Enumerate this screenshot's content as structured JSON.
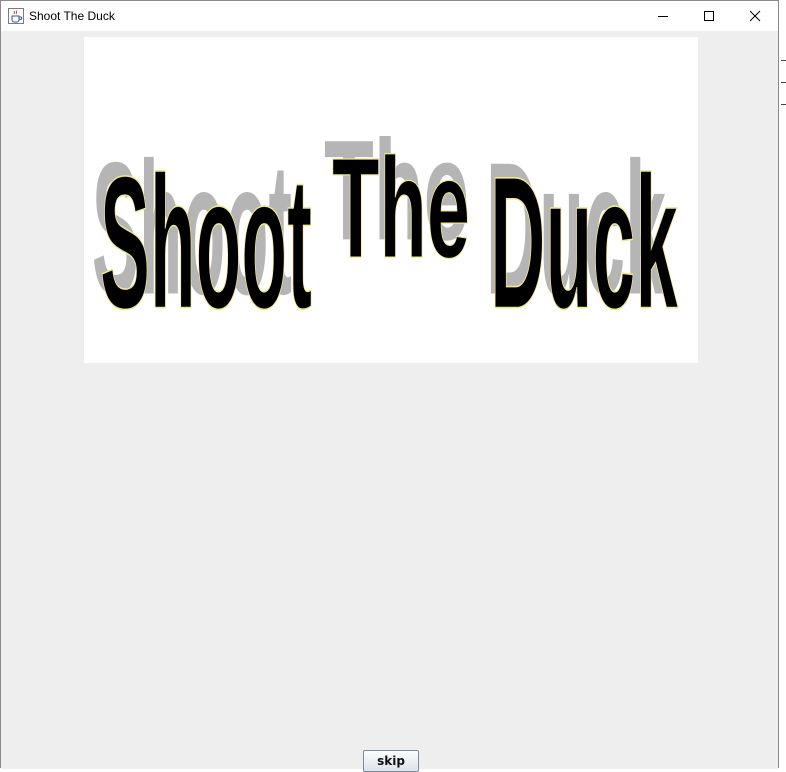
{
  "window": {
    "title": "Shoot The Duck",
    "icon": "java-cup-icon"
  },
  "controls": {
    "minimize_icon": "minimize-icon",
    "maximize_icon": "maximize-icon",
    "close_icon": "close-icon"
  },
  "banner": {
    "words": [
      "Shoot",
      "The",
      "Duck"
    ],
    "fill_color": "#000000",
    "outline_color": "#f0e88a",
    "shadow_color": "#b5b5b5"
  },
  "skip_button": {
    "label": "skip"
  }
}
